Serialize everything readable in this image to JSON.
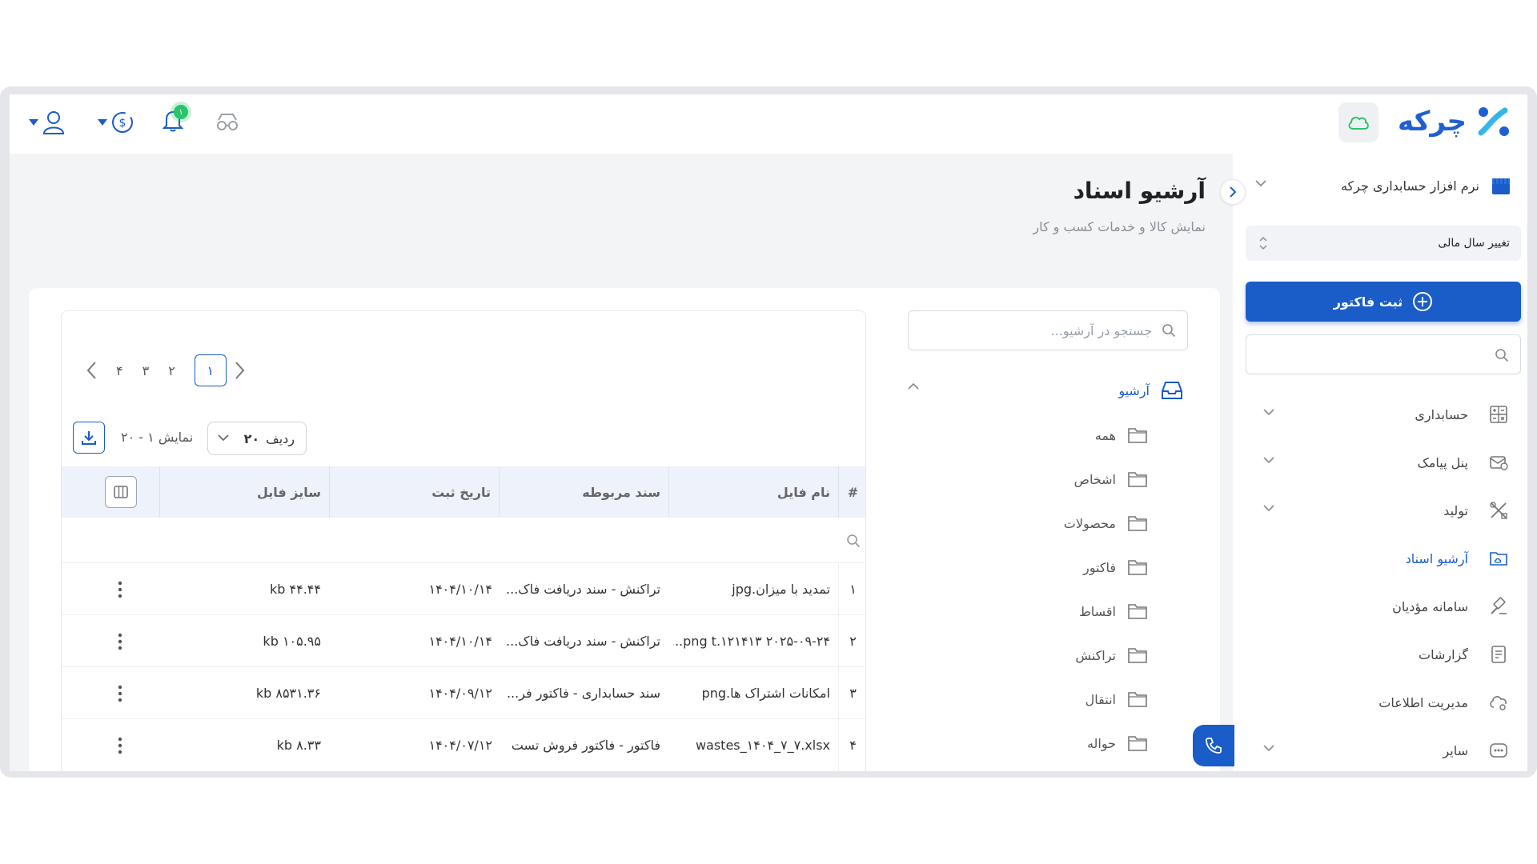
{
  "topbar": {
    "logo_text": "چرکه",
    "notification_count": "۱"
  },
  "sidebar": {
    "company_name": "نرم افزار حسابداری چرکه",
    "fiscal_year_label": "تغییر سال مالی",
    "invoice_button": "ثبت فاکتور",
    "search_placeholder": "",
    "items": [
      {
        "label": "حسابداری",
        "icon": "calculator-icon",
        "has_chevron": true
      },
      {
        "label": "پنل پیامک",
        "icon": "sms-icon",
        "has_chevron": true
      },
      {
        "label": "تولید",
        "icon": "tools-icon",
        "has_chevron": true
      },
      {
        "label": "آرشیو اسناد",
        "icon": "folder-cloud-icon",
        "has_chevron": false,
        "active": true
      },
      {
        "label": "سامانه مؤدیان",
        "icon": "gavel-icon",
        "has_chevron": false
      },
      {
        "label": "گزارشات",
        "icon": "report-icon",
        "has_chevron": false
      },
      {
        "label": "مدیریت اطلاعات",
        "icon": "cloud-gear-icon",
        "has_chevron": false
      },
      {
        "label": "سایر",
        "icon": "more-box-icon",
        "has_chevron": true
      }
    ]
  },
  "page": {
    "title": "آرشیو اسناد",
    "subtitle": "نمایش کالا و خدمات کسب و کار"
  },
  "archive": {
    "search_placeholder": "جستجو در آرشیو...",
    "root_label": "آرشیو",
    "folders": [
      "همه",
      "اشخاص",
      "محصولات",
      "فاکتور",
      "اقساط",
      "تراکنش",
      "انتقال",
      "حواله"
    ]
  },
  "table": {
    "pages": [
      "۱",
      "۲",
      "۳",
      "۴"
    ],
    "current_page": "۱",
    "rows_label": "ردیف",
    "rows_value": "۲۰",
    "showing": "نمایش ۱ - ۲۰",
    "columns": {
      "idx": "#",
      "name": "نام فایل",
      "doc": "سند مربوطه",
      "date": "تاریخ ثبت",
      "size": "سایز فایل"
    },
    "rows": [
      {
        "idx": "۱",
        "name": "تمدید با میزان.jpg",
        "doc": "تراکنش - سند دریافت فاک...",
        "date": "۱۴۰۴/۱۰/۱۴",
        "size": "۴۴.۴۴ kb"
      },
      {
        "idx": "۲",
        "name": "۲۰۲۵-۰۹-۲۴ ۱۲۱۴۱۳.png t...",
        "doc": "تراکنش - سند دریافت فاک...",
        "date": "۱۴۰۴/۱۰/۱۴",
        "size": "۱۰۵.۹۵ kb"
      },
      {
        "idx": "۳",
        "name": "امکانات اشتراک ها.png",
        "doc": "سند حسابداری - فاکتور فر...",
        "date": "۱۴۰۴/۰۹/۱۲",
        "size": "۸۵۳۱.۳۶ kb"
      },
      {
        "idx": "۴",
        "name": "wastes_۱۴۰۴_۷_۷.xlsx",
        "doc": "فاکتور - فاکتور فروش تست",
        "date": "۱۴۰۴/۰۷/۱۲",
        "size": "۸.۳۳ kb"
      }
    ]
  },
  "colors": {
    "accent": "#1a5cc8",
    "badge": "#2cc36b",
    "header_bg": "#eef2fb"
  }
}
